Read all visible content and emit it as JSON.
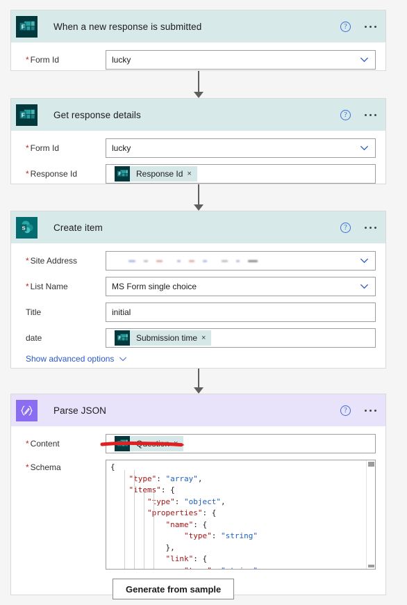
{
  "colors": {
    "connector_header_teal": "#d8e9ea",
    "connector_header_purple": "#e9e2fb",
    "forms_icon_bg": "#03393c",
    "sharepoint_icon_bg": "#036c70",
    "parse_json_icon_bg": "#8a6df0",
    "required_asterisk": "#c4252a",
    "link_blue": "#2a59c8",
    "annotation_red": "#e02020",
    "token_chip_bg": "#d6e7e8"
  },
  "header_actions": {
    "help_label": "?",
    "help_name": "help-icon",
    "menu_name": "more-commands-icon"
  },
  "steps": [
    {
      "id": "when-a-new-response-is-submitted",
      "title": "When a new response is submitted",
      "icon": "microsoft-forms-icon",
      "header_style": "teal",
      "fields": [
        {
          "label": "Form Id",
          "required": true,
          "type": "dropdown",
          "value": "lucky"
        }
      ]
    },
    {
      "id": "get-response-details",
      "title": "Get response details",
      "icon": "microsoft-forms-icon",
      "header_style": "teal",
      "fields": [
        {
          "label": "Form Id",
          "required": true,
          "type": "dropdown",
          "value": "lucky"
        },
        {
          "label": "Response Id",
          "required": true,
          "type": "token",
          "token_label": "Response Id",
          "token_icon": "microsoft-forms-icon",
          "token_remove": "×"
        }
      ]
    },
    {
      "id": "create-item",
      "title": "Create item",
      "icon": "sharepoint-icon",
      "header_style": "teal",
      "fields": [
        {
          "label": "Site Address",
          "required": true,
          "type": "dropdown-redacted",
          "value": ""
        },
        {
          "label": "List Name",
          "required": true,
          "type": "dropdown",
          "value": "MS Form single choice"
        },
        {
          "label": "Title",
          "required": false,
          "type": "text",
          "value": "initial"
        },
        {
          "label": "date",
          "required": false,
          "type": "token",
          "token_label": "Submission time",
          "token_icon": "microsoft-forms-icon",
          "token_remove": "×"
        }
      ],
      "advanced_options_label": "Show advanced options"
    },
    {
      "id": "parse-json",
      "title": "Parse JSON",
      "icon": "parse-json-icon",
      "header_style": "purple",
      "fields": [
        {
          "label": "Content",
          "required": true,
          "type": "token",
          "token_label": "Question",
          "token_icon": "microsoft-forms-icon",
          "token_remove": "×"
        }
      ],
      "schema": {
        "label": "Schema",
        "required": true,
        "lines": [
          [
            {
              "t": "p",
              "v": "{"
            }
          ],
          [
            {
              "t": "p",
              "v": "    "
            },
            {
              "t": "k",
              "v": "\"type\""
            },
            {
              "t": "p",
              "v": ": "
            },
            {
              "t": "s",
              "v": "\"array\""
            },
            {
              "t": "p",
              "v": ","
            }
          ],
          [
            {
              "t": "p",
              "v": "    "
            },
            {
              "t": "k",
              "v": "\"items\""
            },
            {
              "t": "p",
              "v": ": {"
            }
          ],
          [
            {
              "t": "p",
              "v": "        "
            },
            {
              "t": "k",
              "v": "\"type\""
            },
            {
              "t": "p",
              "v": ": "
            },
            {
              "t": "s",
              "v": "\"object\""
            },
            {
              "t": "p",
              "v": ","
            }
          ],
          [
            {
              "t": "p",
              "v": "        "
            },
            {
              "t": "k",
              "v": "\"properties\""
            },
            {
              "t": "p",
              "v": ": {"
            }
          ],
          [
            {
              "t": "p",
              "v": "            "
            },
            {
              "t": "k",
              "v": "\"name\""
            },
            {
              "t": "p",
              "v": ": {"
            }
          ],
          [
            {
              "t": "p",
              "v": "                "
            },
            {
              "t": "k",
              "v": "\"type\""
            },
            {
              "t": "p",
              "v": ": "
            },
            {
              "t": "s",
              "v": "\"string\""
            }
          ],
          [
            {
              "t": "p",
              "v": "            },"
            }
          ],
          [
            {
              "t": "p",
              "v": "            "
            },
            {
              "t": "k",
              "v": "\"link\""
            },
            {
              "t": "p",
              "v": ": {"
            }
          ],
          [
            {
              "t": "p",
              "v": "                "
            },
            {
              "t": "k",
              "v": "\"type\""
            },
            {
              "t": "p",
              "v": ": "
            },
            {
              "t": "s",
              "v": "\"string\""
            }
          ]
        ]
      },
      "generate_button_label": "Generate from sample"
    }
  ],
  "annotations": [
    {
      "name": "red-underline-annotation",
      "shape": "hand-drawn-underline",
      "color": "#e02020"
    }
  ]
}
